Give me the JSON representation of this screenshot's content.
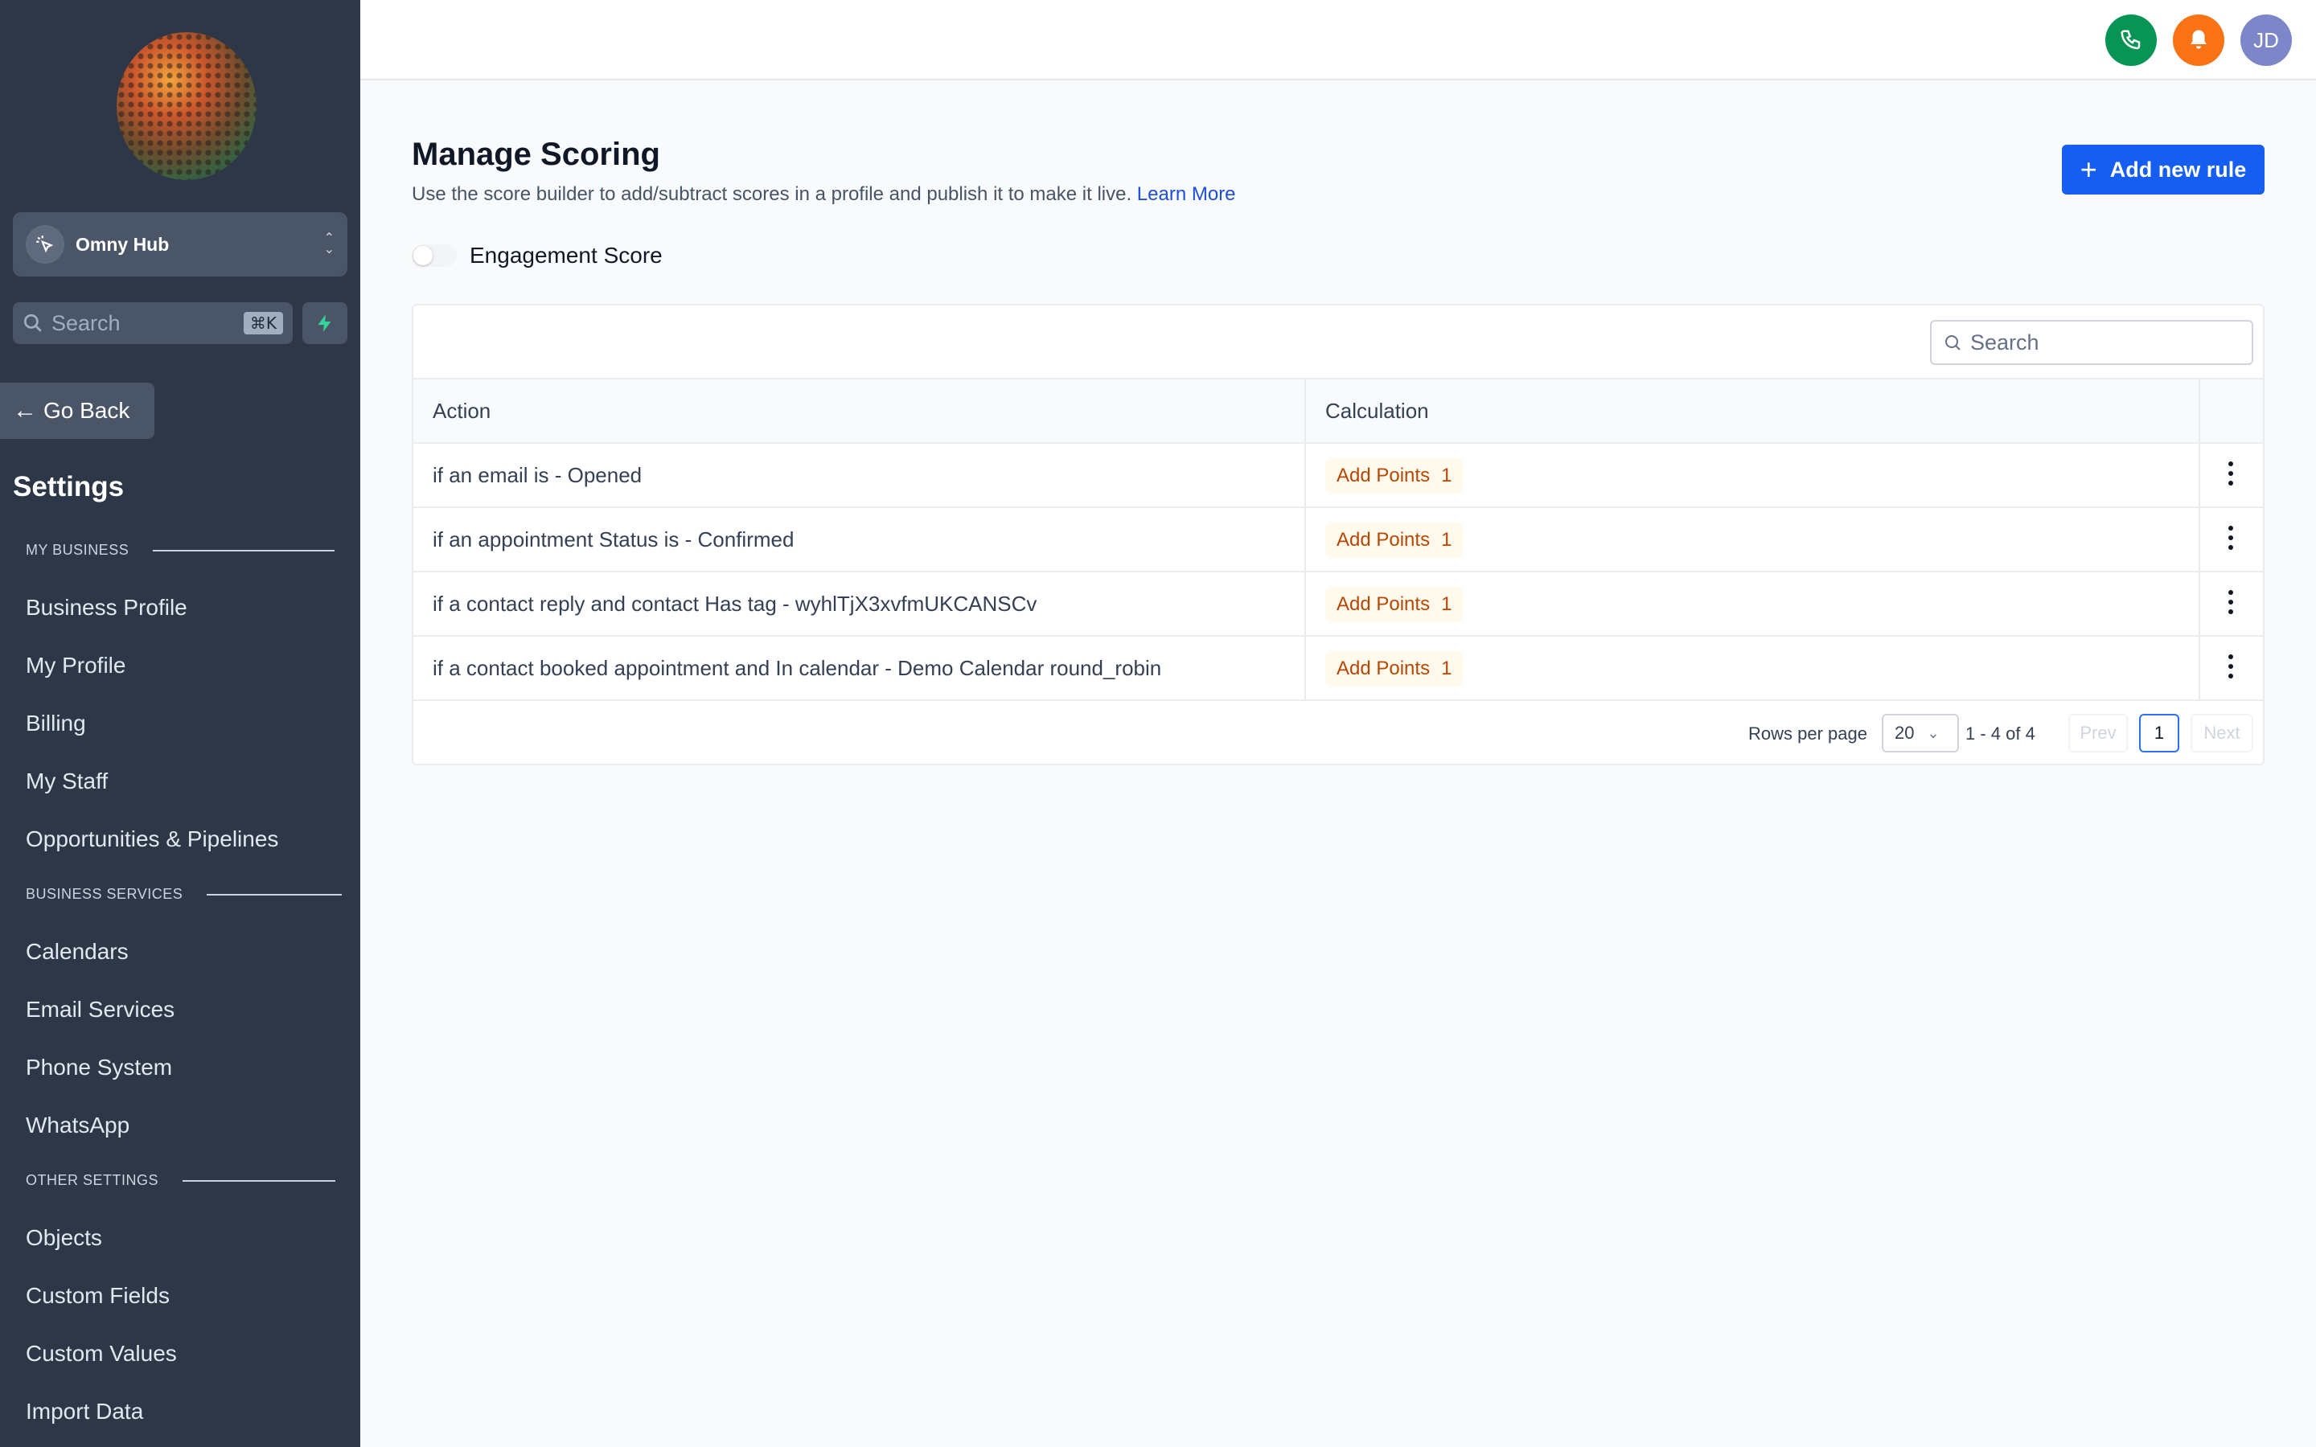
{
  "sidebar": {
    "account_name": "Omny Hub",
    "search_placeholder": "Search",
    "search_shortcut": "⌘K",
    "go_back": "Go Back",
    "settings_title": "Settings",
    "sections": [
      {
        "heading": "MY BUSINESS",
        "items": [
          "Business Profile",
          "My Profile",
          "Billing",
          "My Staff",
          "Opportunities & Pipelines"
        ]
      },
      {
        "heading": "BUSINESS SERVICES",
        "items": [
          "Calendars",
          "Email Services",
          "Phone System",
          "WhatsApp"
        ]
      },
      {
        "heading": "OTHER SETTINGS",
        "items": [
          "Objects",
          "Custom Fields",
          "Custom Values",
          "Import Data"
        ]
      }
    ]
  },
  "topbar": {
    "avatar_initials": "JD",
    "colors": {
      "phone": "#079455",
      "bell": "#f97316",
      "avatar": "#7c86c8"
    }
  },
  "main": {
    "title": "Manage Scoring",
    "subtitle": "Use the score builder to add/subtract scores in a profile and publish it to make it live.",
    "learn_more": "Learn More",
    "add_rule_label": "Add new rule",
    "toggle_label": "Engagement Score",
    "toggle_on": false,
    "table": {
      "search_placeholder": "Search",
      "columns": [
        "Action",
        "Calculation"
      ],
      "rows": [
        {
          "action": "if an email is - Opened",
          "calc_label": "Add Points",
          "points": "1"
        },
        {
          "action": "if an appointment Status is - Confirmed",
          "calc_label": "Add Points",
          "points": "1"
        },
        {
          "action": "if a contact reply and contact Has tag - wyhlTjX3xvfmUKCANSCv",
          "calc_label": "Add Points",
          "points": "1"
        },
        {
          "action": "if a contact booked appointment and In calendar - Demo Calendar round_robin",
          "calc_label": "Add Points",
          "points": "1"
        }
      ]
    },
    "pagination": {
      "rows_per_page_label": "Rows per page",
      "rows_per_page": "20",
      "range": "1 - 4 of 4",
      "prev": "Prev",
      "page": "1",
      "next": "Next"
    }
  },
  "colors": {
    "sidebar_bg": "#2d3748",
    "primary": "#155eef",
    "badge_bg": "#fffaeb",
    "badge_text": "#b54708"
  }
}
